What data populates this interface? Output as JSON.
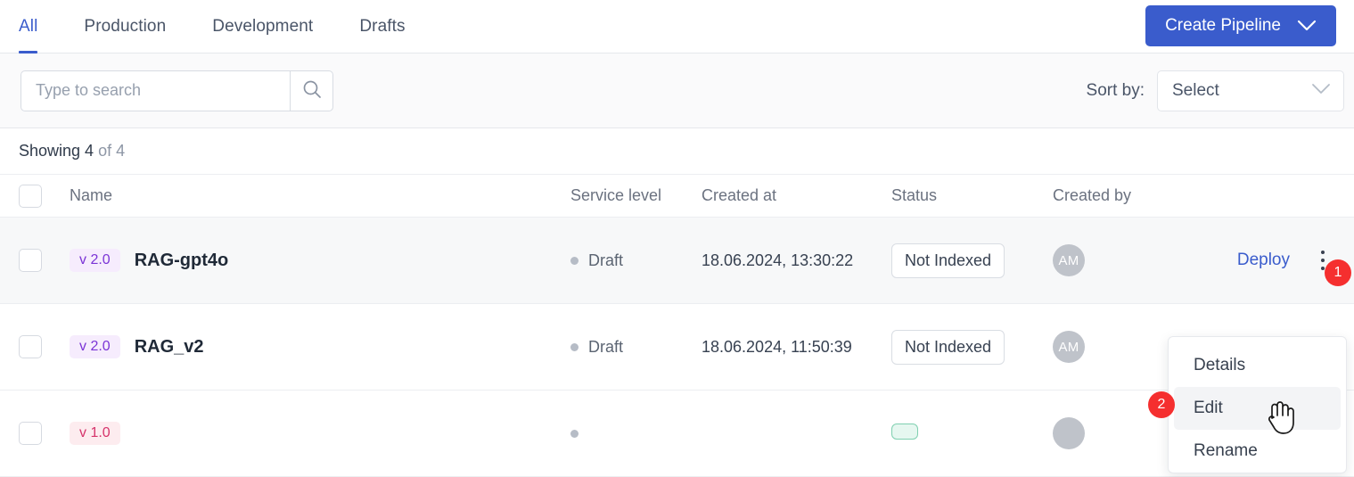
{
  "tabs": [
    {
      "label": "All",
      "active": true
    },
    {
      "label": "Production",
      "active": false
    },
    {
      "label": "Development",
      "active": false
    },
    {
      "label": "Drafts",
      "active": false
    }
  ],
  "header": {
    "create_button_label": "Create Pipeline",
    "create_button_icon": "chevron-down-icon",
    "accent_color": "#3a5ccc"
  },
  "toolbar": {
    "search_placeholder": "Type to search",
    "search_value": "",
    "search_icon": "search-icon",
    "sort_label": "Sort by:",
    "sort_value": "Select",
    "sort_icon": "chevron-down-icon"
  },
  "results": {
    "showing_text": "Showing 4",
    "of_text": "of 4"
  },
  "table": {
    "columns": [
      "Name",
      "Service level",
      "Created at",
      "Status",
      "Created by"
    ],
    "rows": [
      {
        "version": "v 2.0",
        "version_style": "purple",
        "name": "RAG-gpt4o",
        "service_level": "Draft",
        "created_at": "18.06.2024, 13:30:22",
        "status": "Not Indexed",
        "status_style": "default",
        "created_by": "AM",
        "action_label": "Deploy",
        "hovered": true
      },
      {
        "version": "v 2.0",
        "version_style": "purple",
        "name": "RAG_v2",
        "service_level": "Draft",
        "created_at": "18.06.2024, 11:50:39",
        "status": "Not Indexed",
        "status_style": "default",
        "created_by": "AM",
        "action_label": "",
        "hovered": false
      },
      {
        "version": "v 1.0",
        "version_style": "pink",
        "name": "",
        "service_level": "",
        "created_at": "",
        "status": "",
        "status_style": "green",
        "created_by": "",
        "action_label": "",
        "hovered": false
      }
    ]
  },
  "context_menu": {
    "items": [
      {
        "label": "Details",
        "active": false
      },
      {
        "label": "Edit",
        "active": true
      },
      {
        "label": "Rename",
        "active": false
      }
    ]
  },
  "annotations": {
    "badge_1": "1",
    "badge_2": "2",
    "badge_color": "#f52f2f"
  }
}
